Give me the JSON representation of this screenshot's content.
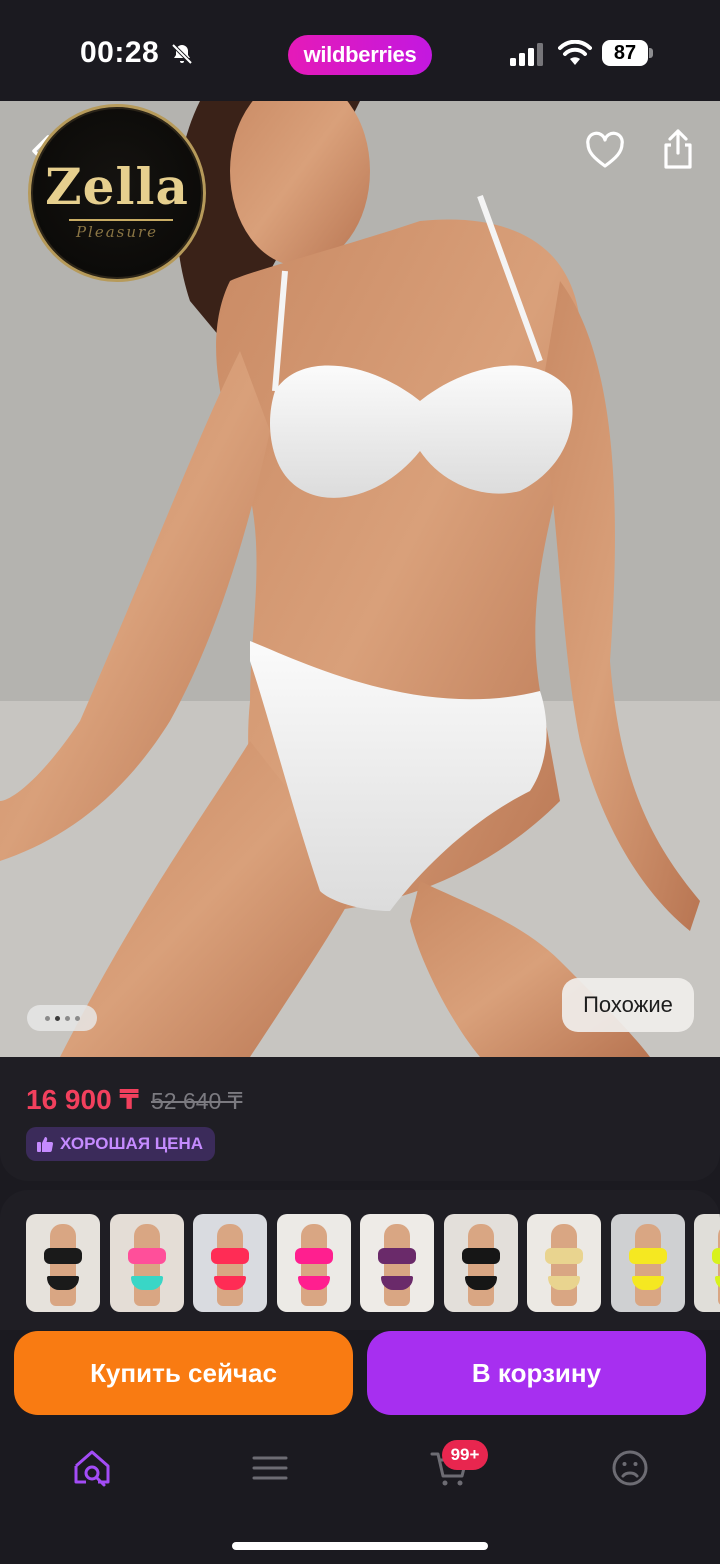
{
  "status_bar": {
    "time": "00:28",
    "brand": "wildberries",
    "battery": "87",
    "icons": [
      "bell-off-icon",
      "cellular-signal-icon",
      "wifi-icon",
      "battery-icon"
    ]
  },
  "hero": {
    "logo_text": "Zella",
    "logo_subtext": "Pleasure",
    "similar_label": "Похожие",
    "gallery_page_count": 4,
    "gallery_active_index": 1,
    "icons": [
      "back-icon",
      "heart-icon",
      "share-icon"
    ]
  },
  "price": {
    "current": "16 900 ₸",
    "old": "52 640 ₸",
    "badge": "ХОРОШАЯ ЦЕНА",
    "badge_icon": "thumbs-up-icon"
  },
  "variants": {
    "items": [
      {
        "top": "#1a1a1a",
        "bottom": "#1a1a1a",
        "bg": "#e6e2dc"
      },
      {
        "top": "#ff4f9a",
        "bottom": "#39d6c6",
        "bg": "#e4ddd6"
      },
      {
        "top": "#ff2c55",
        "bottom": "#ff2c55",
        "bg": "#d9dbe0"
      },
      {
        "top": "#ff1f8f",
        "bottom": "#ff1f8f",
        "bg": "#eceae6"
      },
      {
        "top": "#6a2a6a",
        "bottom": "#6a2a6a",
        "bg": "#eeebe7"
      },
      {
        "top": "#161616",
        "bottom": "#161616",
        "bg": "#e3dfda"
      },
      {
        "top": "#e9d48f",
        "bottom": "#e9d48f",
        "bg": "#ece9e4"
      },
      {
        "top": "#f5e821",
        "bottom": "#f5e821",
        "bg": "#cfd0d2"
      },
      {
        "top": "#d8f21c",
        "bottom": "#d8f21c",
        "bg": "#e0ded9"
      }
    ]
  },
  "actions": {
    "buy_now": "Купить сейчас",
    "add_to_cart": "В корзину"
  },
  "tabbar": {
    "items": [
      "home-search-icon",
      "catalog-menu-icon",
      "cart-icon",
      "profile-icon"
    ],
    "cart_badge": "99+",
    "active_color": "#a34cf6",
    "inactive_color": "#6d6c73"
  },
  "colors": {
    "background": "#1b1a20",
    "price_red": "#f2405d",
    "buy_orange": "#f97b12",
    "cart_purple": "#a72ff0",
    "brand_pink": "#e51ab8"
  }
}
